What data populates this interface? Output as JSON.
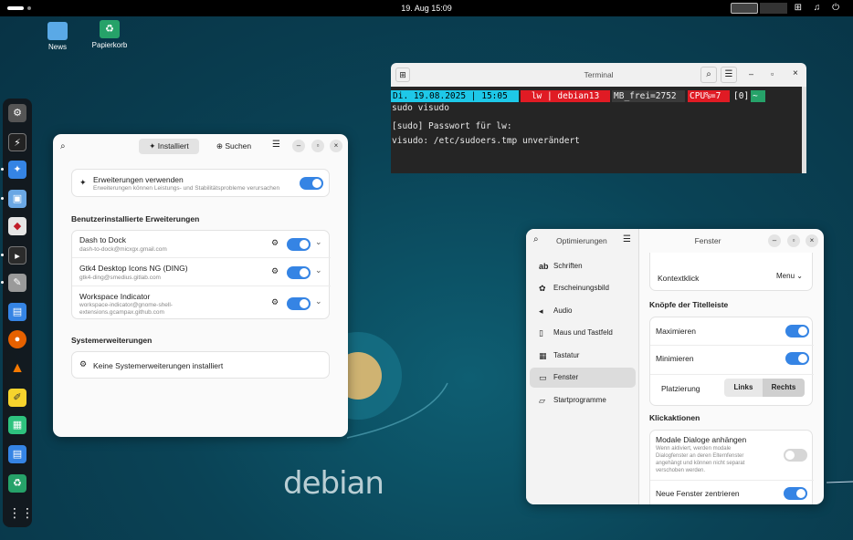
{
  "topbar": {
    "clock": "19. Aug  15:09",
    "tray_icons": "⊞ ♫ ⏻"
  },
  "desktop": {
    "icons": [
      {
        "label": "News",
        "icon": "folder-icon",
        "color": "#5aa9e6"
      },
      {
        "label": "Papierkorb",
        "icon": "trash-icon",
        "color": "#26a269"
      }
    ],
    "watermark": "debian"
  },
  "dock": {
    "apps": [
      "settings-icon",
      "system-monitor-icon",
      "extensions-icon",
      "software-icon",
      "shop-icon",
      "terminal-icon",
      "tools-icon",
      "files-icon",
      "firefox-icon",
      "vlc-icon",
      "text-editor-icon",
      "calc-icon",
      "writer-icon",
      "trash-icon",
      "app-grid-icon"
    ]
  },
  "extensions": {
    "tabs": {
      "installed": "Installiert",
      "search": "Suchen"
    },
    "use_extensions": {
      "title": "Erweiterungen verwenden",
      "subtitle": "Erweiterungen können Leistungs- und Stabilitätsprobleme verursachen",
      "enabled": true
    },
    "user_heading": "Benutzerinstallierte Erweiterungen",
    "user_extensions": [
      {
        "name": "Dash to Dock",
        "id": "dash-to-dock@micxgx.gmail.com",
        "enabled": true
      },
      {
        "name": "Gtk4 Desktop Icons NG (DING)",
        "id": "gtk4-ding@smedius.gitlab.com",
        "enabled": true
      },
      {
        "name": "Workspace Indicator",
        "id": "workspace-indicator@gnome-shell-extensions.gcampax.github.com",
        "enabled": true
      }
    ],
    "system_heading": "Systemerweiterungen",
    "system_empty": "Keine Systemerweiterungen installiert"
  },
  "terminal": {
    "title": "Terminal",
    "prompt": {
      "date": "Di. 19.08.2025 | 15:05",
      "user": "lw | debian13",
      "mem": "MB_frei=2752",
      "cpu": "CPU%=7",
      "jobs": "[0]",
      "dir": "~"
    },
    "lines": [
      "sudo visudo",
      "",
      "[sudo] Passwort für lw:",
      "visudo: /etc/sudoers.tmp unverändert"
    ],
    "colors": {
      "date": "#1ec8e8",
      "user": "#e01b24",
      "cpu": "#e01b24",
      "dir": "#26a269"
    }
  },
  "tweaks": {
    "sidebar_title": "Optimierungen",
    "title": "Fenster",
    "nav": [
      {
        "label": "Schriften",
        "icon": "font-icon"
      },
      {
        "label": "Erscheinungsbild",
        "icon": "appearance-icon"
      },
      {
        "label": "Audio",
        "icon": "audio-icon"
      },
      {
        "label": "Maus und Tastfeld",
        "icon": "mouse-icon"
      },
      {
        "label": "Tastatur",
        "icon": "keyboard-icon"
      },
      {
        "label": "Fenster",
        "icon": "window-icon"
      },
      {
        "label": "Startprogramme",
        "icon": "folder-icon"
      }
    ],
    "selected": "Fenster",
    "context_click": {
      "label": "Kontextklick",
      "value": "Menu"
    },
    "titlebar_heading": "Knöpfe der Titelleiste",
    "maximize": {
      "label": "Maximieren",
      "enabled": true
    },
    "minimize": {
      "label": "Minimieren",
      "enabled": true
    },
    "placement": {
      "label": "Platzierung",
      "left": "Links",
      "right": "Rechts",
      "selected": "Rechts"
    },
    "click_heading": "Klickaktionen",
    "modal": {
      "label": "Modale Dialoge anhängen",
      "desc": "Wenn aktiviert, werden modale Dialogfenster an deren Elternfenster angehängt und können nicht separat verschoben werden.",
      "enabled": false
    },
    "center": {
      "label": "Neue Fenster zentrieren",
      "enabled": true
    }
  }
}
